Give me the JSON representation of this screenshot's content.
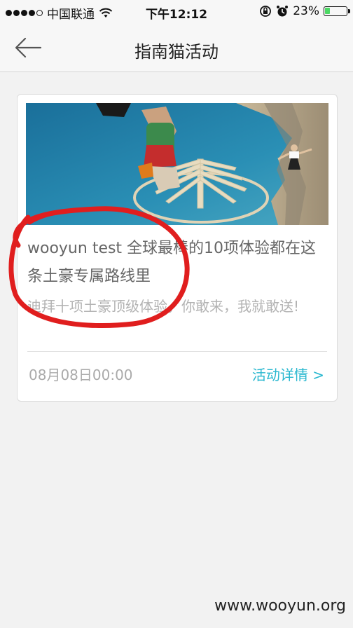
{
  "status_bar": {
    "carrier": "中国联通",
    "time": "下午12:12",
    "battery_percent": "23%",
    "battery_level": 0.23
  },
  "nav": {
    "title": "指南猫活动"
  },
  "card": {
    "title": "wooyun  test  全球最棒的10项体验都在这条土豪专属路线里",
    "description": "迪拜十项土豪顶级体验，你敢来，我就敢送!",
    "date": "08月08日00:00",
    "link_label": "活动详情 >"
  },
  "watermark": "www.wooyun.org",
  "colors": {
    "accent": "#27b7cf",
    "annotation": "#e01e1e",
    "battery": "#4cd964"
  }
}
